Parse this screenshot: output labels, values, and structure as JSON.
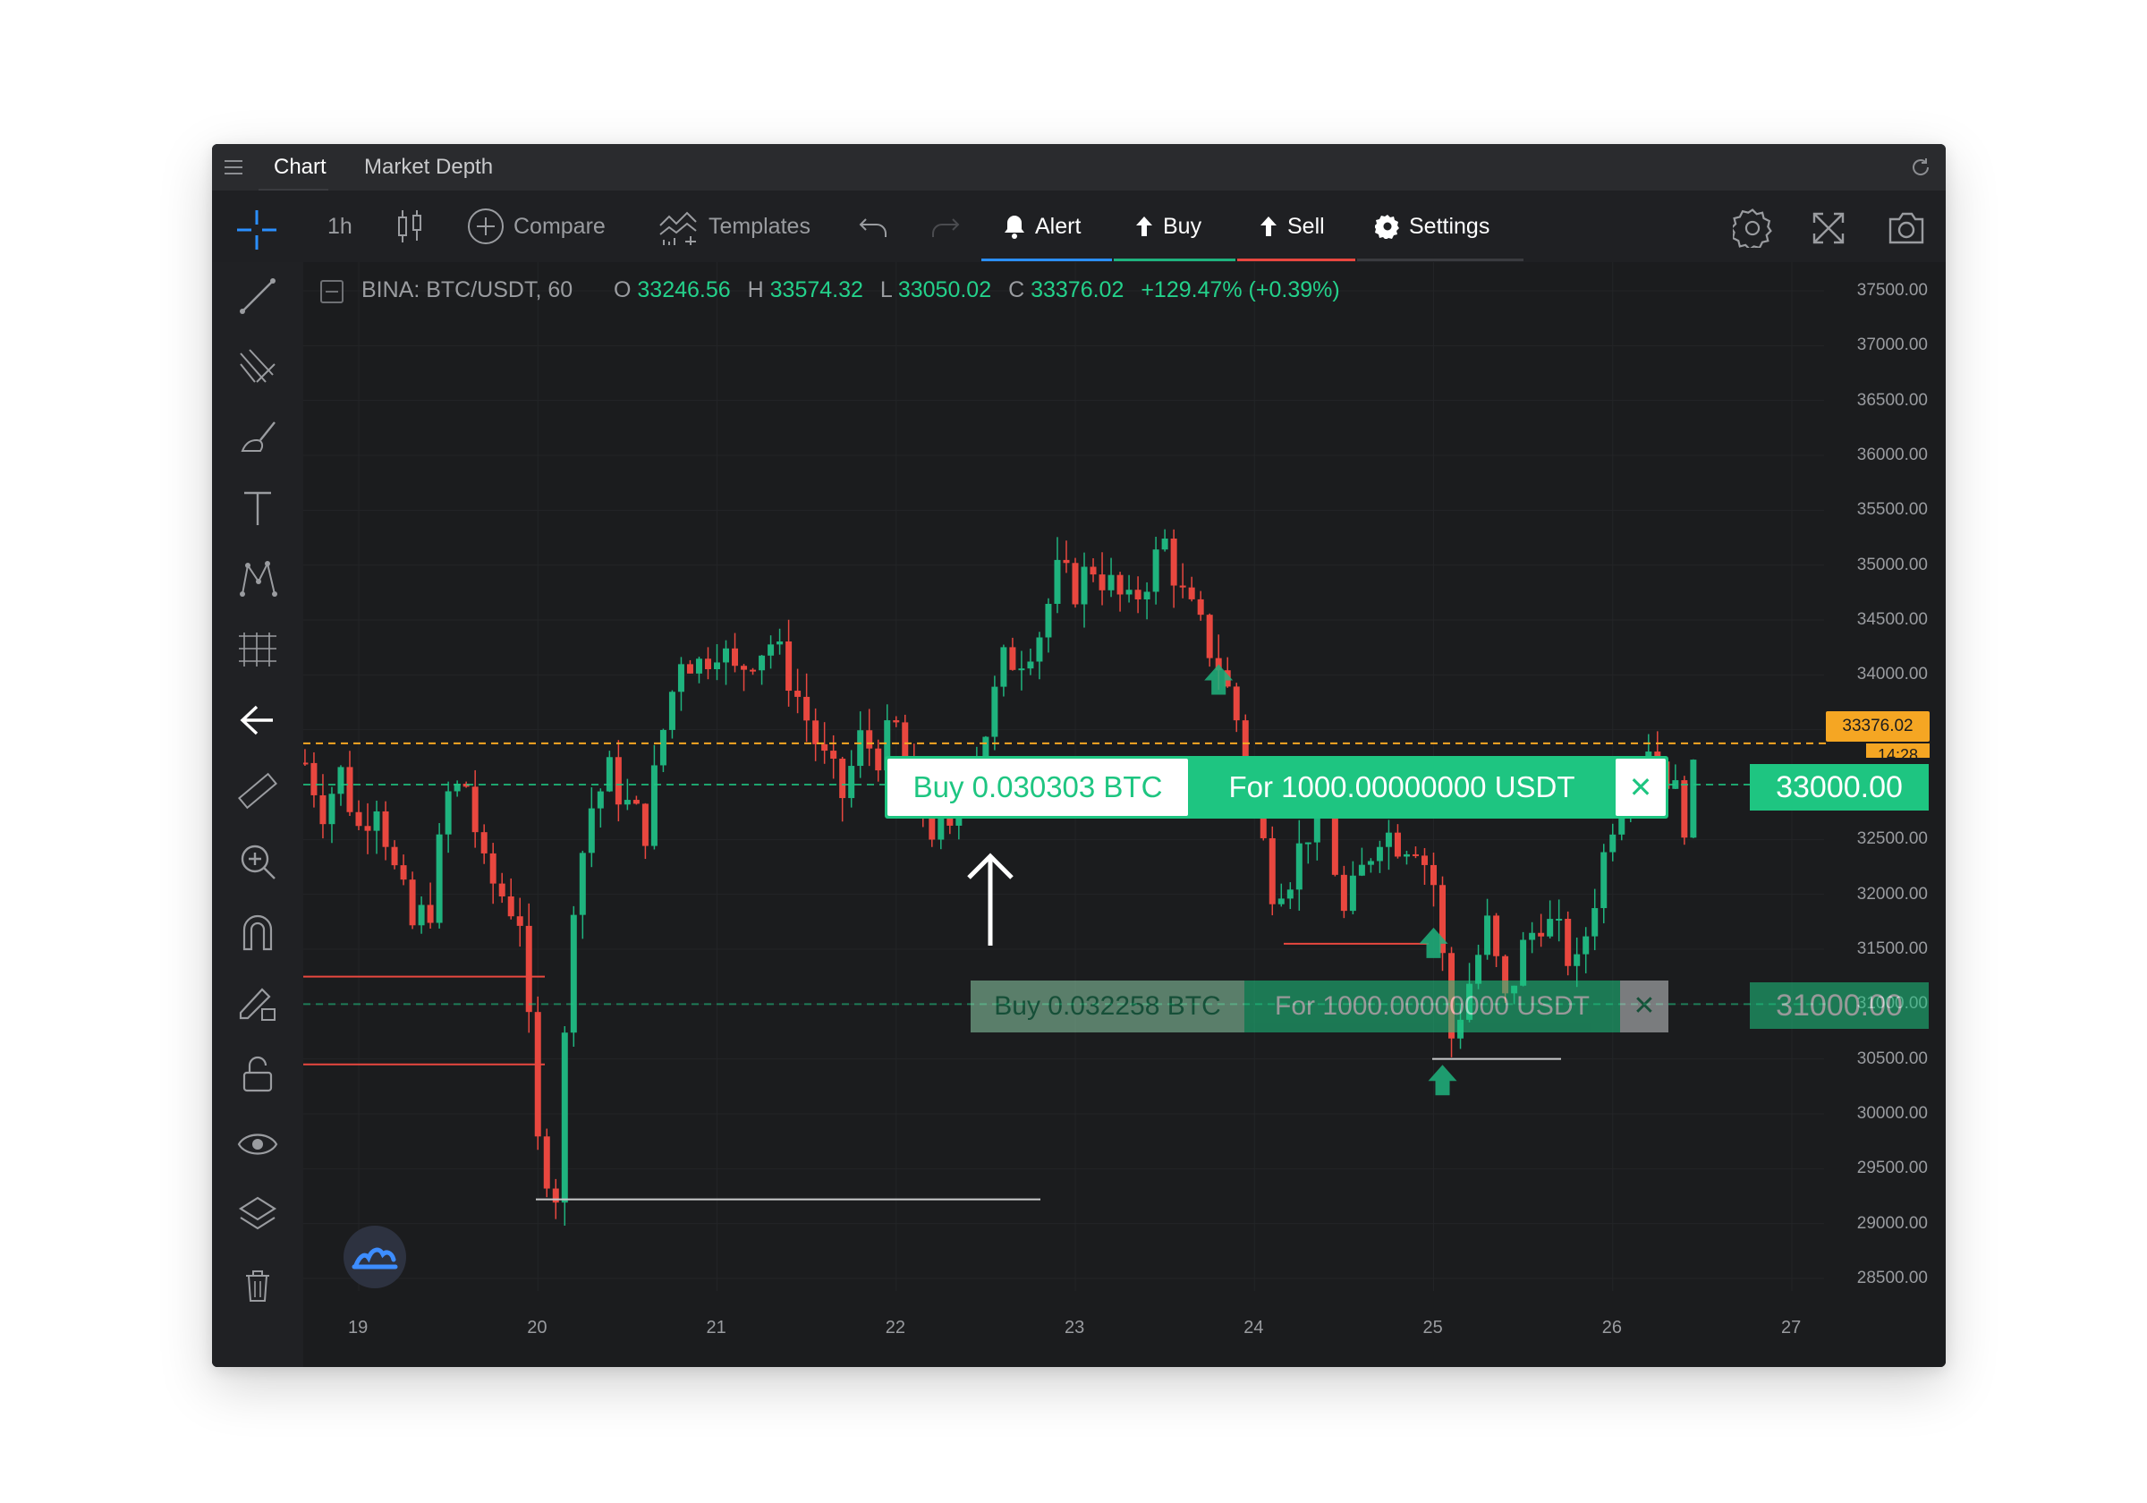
{
  "tabs": {
    "chart": "Chart",
    "market_depth": "Market Depth"
  },
  "toolbar": {
    "interval": "1h",
    "compare": "Compare",
    "templates": "Templates",
    "alert": "Alert",
    "buy": "Buy",
    "sell": "Sell",
    "settings": "Settings"
  },
  "legend": {
    "symbol": "BINA: BTC/USDT, 60",
    "o_label": "O",
    "o_value": "33246.56",
    "h_label": "H",
    "h_value": "33574.32",
    "l_label": "L",
    "l_value": "33050.02",
    "c_label": "C",
    "c_value": "33376.02",
    "change": "+129.47% (+0.39%)"
  },
  "price_axis": [
    "37500.00",
    "37000.00",
    "36500.00",
    "36000.00",
    "35500.00",
    "35000.00",
    "34500.00",
    "34000.00",
    "33500.00",
    "33000.00",
    "32500.00",
    "32000.00",
    "31500.00",
    "31000.00",
    "30500.00",
    "30000.00",
    "29500.00",
    "29000.00",
    "28500.00"
  ],
  "date_axis": [
    "19",
    "20",
    "21",
    "22",
    "23",
    "24",
    "25",
    "26",
    "27"
  ],
  "last_price": {
    "value": "33376.02",
    "countdown": "14:28"
  },
  "orders": [
    {
      "buy": "Buy 0.030303 BTC",
      "for": "For 1000.00000000 USDT",
      "close": "✕",
      "price": "33000.00"
    },
    {
      "buy": "Buy 0.032258 BTC",
      "for": "For 1000.00000000 USDT",
      "close": "✕",
      "price": "31000.00"
    }
  ],
  "colors": {
    "up": "#1fb37e",
    "down": "#e8473f",
    "order_green": "#1ec581",
    "last_price_bg": "#f5a623",
    "background": "#1b1c1e"
  },
  "chart_data": {
    "type": "candlestick",
    "symbol": "BTC/USDT",
    "interval": "60",
    "ylim": [
      28500,
      37500
    ],
    "x_ticks": [
      "19",
      "20",
      "21",
      "22",
      "23",
      "24",
      "25",
      "26",
      "27"
    ],
    "y_ticks": [
      37500,
      37000,
      36500,
      36000,
      35500,
      35000,
      34500,
      34000,
      33500,
      33000,
      32500,
      32000,
      31500,
      31000,
      30500,
      30000,
      29500,
      29000,
      28500
    ],
    "close_path": [
      [
        18.7,
        33200
      ],
      [
        18.8,
        32800
      ],
      [
        18.9,
        33100
      ],
      [
        19.0,
        32600
      ],
      [
        19.1,
        32900
      ],
      [
        19.2,
        32200
      ],
      [
        19.3,
        31700
      ],
      [
        19.4,
        31900
      ],
      [
        19.5,
        32900
      ],
      [
        19.6,
        33000
      ],
      [
        19.7,
        32200
      ],
      [
        19.8,
        32000
      ],
      [
        19.9,
        31800
      ],
      [
        20.0,
        29700
      ],
      [
        20.1,
        29300
      ],
      [
        20.2,
        32000
      ],
      [
        20.3,
        32800
      ],
      [
        20.4,
        33100
      ],
      [
        20.5,
        32800
      ],
      [
        20.6,
        32600
      ],
      [
        20.7,
        33500
      ],
      [
        20.8,
        34200
      ],
      [
        20.9,
        34100
      ],
      [
        21.0,
        34300
      ],
      [
        21.1,
        34000
      ],
      [
        21.2,
        34200
      ],
      [
        21.3,
        34300
      ],
      [
        21.4,
        34000
      ],
      [
        21.5,
        33600
      ],
      [
        21.6,
        33200
      ],
      [
        21.7,
        32900
      ],
      [
        21.8,
        33400
      ],
      [
        21.9,
        33300
      ],
      [
        22.0,
        33500
      ],
      [
        22.1,
        33000
      ],
      [
        22.2,
        32600
      ],
      [
        22.3,
        32500
      ],
      [
        22.4,
        33200
      ],
      [
        22.5,
        33500
      ],
      [
        22.6,
        34100
      ],
      [
        22.7,
        34200
      ],
      [
        22.8,
        34400
      ],
      [
        22.9,
        34900
      ],
      [
        23.0,
        34800
      ],
      [
        23.1,
        35000
      ],
      [
        23.2,
        34800
      ],
      [
        23.3,
        34600
      ],
      [
        23.4,
        34900
      ],
      [
        23.5,
        35200
      ],
      [
        23.6,
        34700
      ],
      [
        23.7,
        34400
      ],
      [
        23.8,
        34100
      ],
      [
        23.9,
        33600
      ],
      [
        24.0,
        32800
      ],
      [
        24.1,
        32100
      ],
      [
        24.2,
        32200
      ],
      [
        24.3,
        32600
      ],
      [
        24.4,
        32700
      ],
      [
        24.5,
        31800
      ],
      [
        24.6,
        32200
      ],
      [
        24.7,
        32600
      ],
      [
        24.8,
        32500
      ],
      [
        24.9,
        32500
      ],
      [
        25.0,
        32100
      ],
      [
        25.1,
        30700
      ],
      [
        25.2,
        31200
      ],
      [
        25.3,
        31700
      ],
      [
        25.4,
        31000
      ],
      [
        25.5,
        31500
      ],
      [
        25.6,
        31800
      ],
      [
        25.7,
        31600
      ],
      [
        25.8,
        31300
      ],
      [
        25.9,
        32000
      ],
      [
        26.0,
        32700
      ],
      [
        26.1,
        33200
      ],
      [
        26.2,
        33400
      ],
      [
        26.3,
        33100
      ],
      [
        26.4,
        32700
      ],
      [
        26.5,
        33376
      ]
    ],
    "horizontal_lines": [
      {
        "price": 33376.02,
        "style": "dashed",
        "label": "33376.02"
      },
      {
        "price": 33000,
        "style": "dashed",
        "label": "33000.00"
      },
      {
        "price": 31000,
        "style": "dashed",
        "label": "31000.00"
      }
    ]
  }
}
